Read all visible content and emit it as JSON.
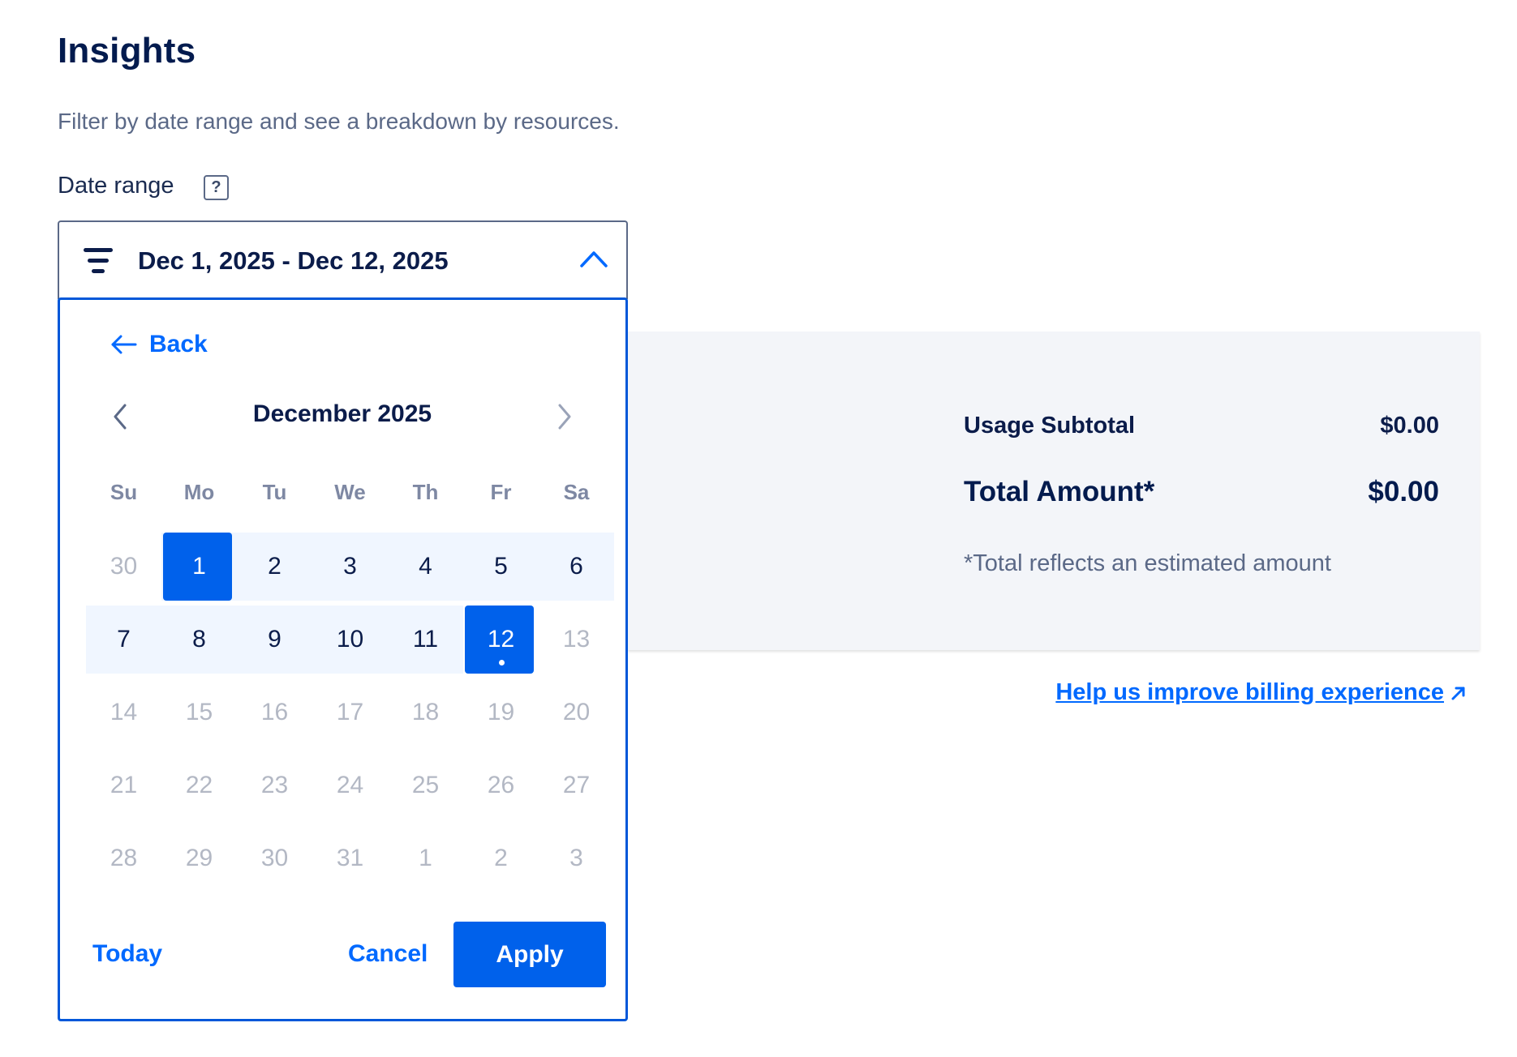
{
  "header": {
    "title": "Insights",
    "subtitle": "Filter by date range and see a breakdown by resources."
  },
  "date_range": {
    "label": "Date range",
    "help_icon": "question-icon",
    "help_glyph": "?",
    "value": "Dec 1, 2025 - Dec 12, 2025",
    "filter_icon": "filter-icon",
    "toggle_icon": "chevron-up-icon"
  },
  "summary": {
    "usage_subtotal_label": "Usage Subtotal",
    "usage_subtotal_value": "$0.00",
    "total_amount_label": "Total Amount*",
    "total_amount_value": "$0.00",
    "note": "*Total reflects an estimated amount"
  },
  "feedback_link": {
    "label": "Help us improve billing experience",
    "icon": "external-link-icon"
  },
  "calendar": {
    "back_label": "Back",
    "month_title": "December 2025",
    "weekdays": [
      "Su",
      "Mo",
      "Tu",
      "We",
      "Th",
      "Fr",
      "Sa"
    ],
    "weeks": [
      [
        "30",
        "1",
        "2",
        "3",
        "4",
        "5",
        "6"
      ],
      [
        "7",
        "8",
        "9",
        "10",
        "11",
        "12",
        "13"
      ],
      [
        "14",
        "15",
        "16",
        "17",
        "18",
        "19",
        "20"
      ],
      [
        "21",
        "22",
        "23",
        "24",
        "25",
        "26",
        "27"
      ],
      [
        "28",
        "29",
        "30",
        "31",
        "1",
        "2",
        "3"
      ]
    ],
    "range_start": "1",
    "range_end": "12",
    "today": "12",
    "today_label": "Today",
    "cancel_label": "Cancel",
    "apply_label": "Apply",
    "accent_color": "#0061eb"
  }
}
